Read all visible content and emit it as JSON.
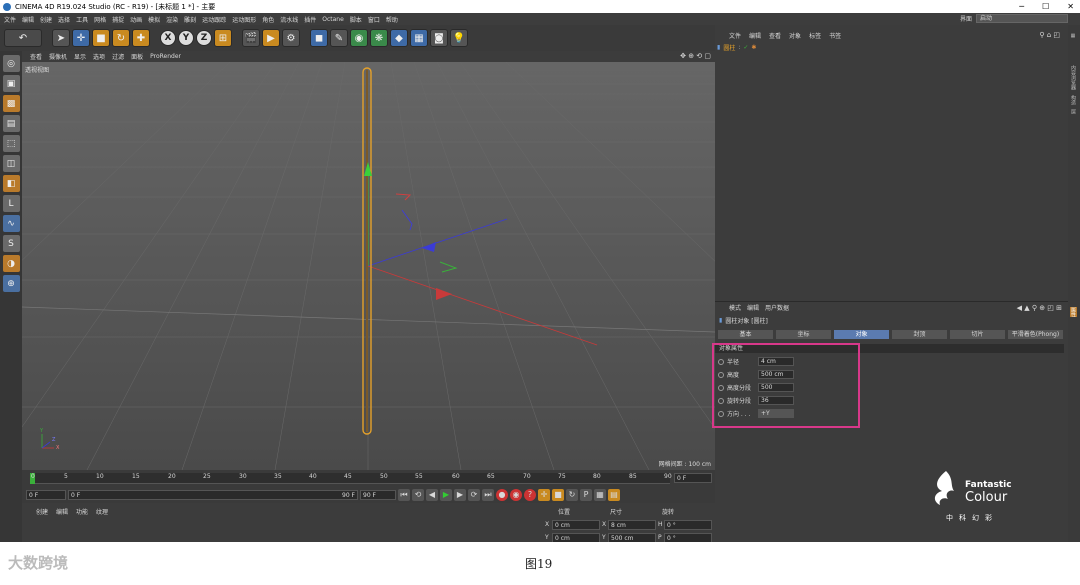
{
  "window": {
    "title": "CINEMA 4D R19.024 Studio (RC - R19) - [未标题 1 *] - 主要",
    "min": "─",
    "max": "☐",
    "close": "✕"
  },
  "menubar": {
    "items": [
      "文件",
      "编辑",
      "创建",
      "选择",
      "工具",
      "网格",
      "捕捉",
      "动画",
      "模拟",
      "渲染",
      "雕刻",
      "运动跟踪",
      "运动图形",
      "角色",
      "流水线",
      "插件",
      "Octane",
      "脚本",
      "窗口",
      "帮助"
    ],
    "layout_label": "界面",
    "layout_value": "启动"
  },
  "viewport": {
    "menu": [
      "查看",
      "摄像机",
      "显示",
      "选项",
      "过滤",
      "面板",
      "ProRender"
    ],
    "label": "透视视图",
    "grid_scale": "网格间距 : 100 cm",
    "axis_y": "Y",
    "axis_z": "Z",
    "axis_x": "X"
  },
  "timeline": {
    "ticks": [
      "0",
      "5",
      "10",
      "15",
      "20",
      "25",
      "30",
      "35",
      "40",
      "45",
      "50",
      "55",
      "60",
      "65",
      "70",
      "75",
      "80",
      "85",
      "90"
    ],
    "end_field": "0 F"
  },
  "transport": {
    "current": "0 F",
    "start": "0 F",
    "end": "90 F",
    "end2": "90 F"
  },
  "material": {
    "menu": [
      "创建",
      "编辑",
      "功能",
      "纹理"
    ]
  },
  "coords": {
    "headers": [
      "位置",
      "尺寸",
      "旋转"
    ],
    "row1": {
      "a": "X",
      "av": "0 cm",
      "b": "X",
      "bv": "8 cm",
      "c": "H",
      "cv": "0 °"
    },
    "row2": {
      "a": "Y",
      "av": "0 cm",
      "b": "Y",
      "bv": "500 cm",
      "c": "P",
      "cv": "0 °"
    }
  },
  "objects": {
    "menu": [
      "文件",
      "编辑",
      "查看",
      "对象",
      "标签",
      "书签"
    ],
    "item": "圆柱"
  },
  "attributes": {
    "menu": [
      "模式",
      "编辑",
      "用户数据"
    ],
    "title": "圆柱对象 [圆柱]",
    "tabs": [
      "基本",
      "坐标",
      "对象",
      "封顶",
      "切片",
      "平滑着色(Phong)"
    ],
    "selected_tab": 2,
    "section": "对象属性",
    "props": [
      {
        "label": "半径",
        "value": "4 cm"
      },
      {
        "label": "高度",
        "value": "500 cm"
      },
      {
        "label": "高度分段",
        "value": "500"
      },
      {
        "label": "旋转分段",
        "value": "36"
      },
      {
        "label": "方向 . . .",
        "value": "+Y"
      }
    ]
  },
  "right_edge": [
    "内容浏览器",
    "构造",
    "层"
  ],
  "right_edge_lower": "属性",
  "brand": {
    "name1": "Fantastic",
    "name2": "Colour",
    "cn": "中科幻彩"
  },
  "figure": {
    "caption": "图19"
  },
  "watermark": "大数跨境"
}
